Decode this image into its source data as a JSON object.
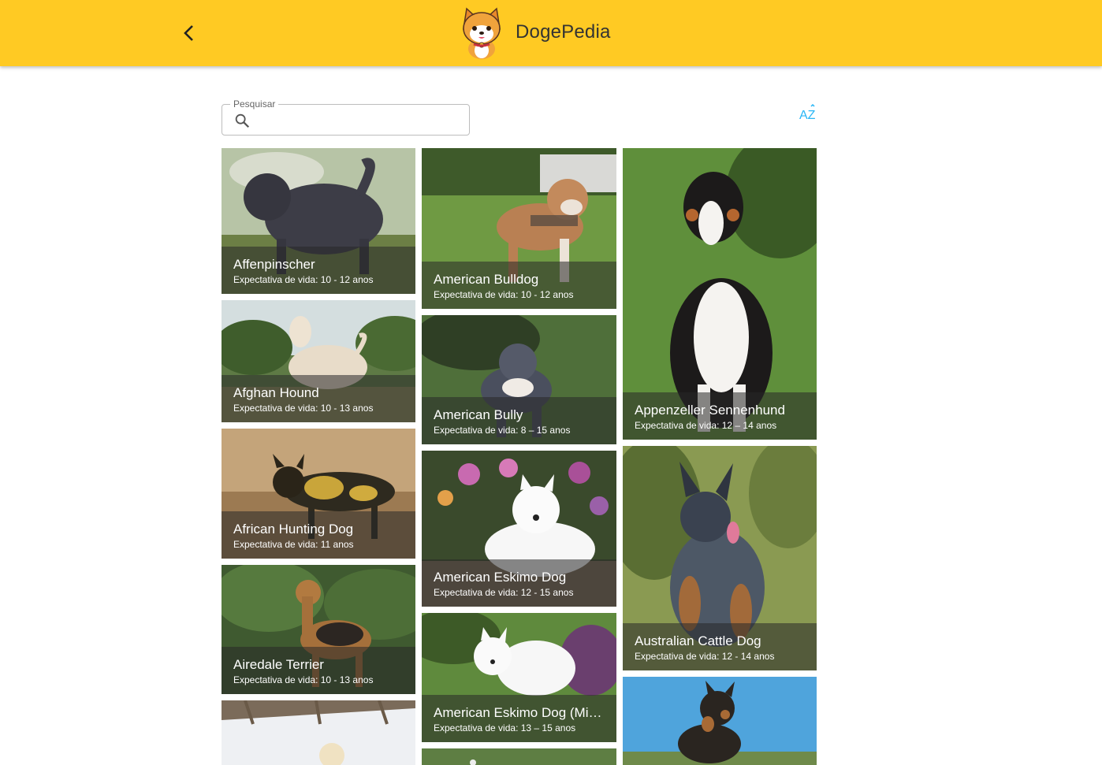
{
  "header": {
    "title": "DogePedia",
    "back_icon": "arrow-back-icon",
    "logo": "shiba-logo"
  },
  "search": {
    "label": "Pesquisar",
    "value": "",
    "icon": "search-icon"
  },
  "sort": {
    "icon": "sort-az-icon",
    "label": "AZ",
    "color": "#29b6f6"
  },
  "colors": {
    "appbar": "#ffca23",
    "caption_overlay": "rgba(40,40,40,0.55)"
  },
  "breeds": [
    {
      "name": "Affenpinscher",
      "life": "Expectativa de vida: 10 - 12 anos"
    },
    {
      "name": "Afghan Hound",
      "life": "Expectativa de vida: 10 - 13 anos"
    },
    {
      "name": "African Hunting Dog",
      "life": "Expectativa de vida: 11 anos"
    },
    {
      "name": "Airedale Terrier",
      "life": "Expectativa de vida: 10 - 13 anos"
    },
    {
      "name": "American Bulldog",
      "life": "Expectativa de vida: 10 - 12 anos"
    },
    {
      "name": "American Bully",
      "life": "Expectativa de vida: 8 – 15 anos"
    },
    {
      "name": "American Eskimo Dog",
      "life": "Expectativa de vida: 12 - 15 anos"
    },
    {
      "name": "American Eskimo Dog (Miniature)",
      "life": "Expectativa de vida: 13 – 15 anos"
    },
    {
      "name": "Appenzeller Sennenhund",
      "life": "Expectativa de vida: 12 – 14 anos"
    },
    {
      "name": "Australian Cattle Dog",
      "life": "Expectativa de vida: 12 - 14 anos"
    }
  ]
}
